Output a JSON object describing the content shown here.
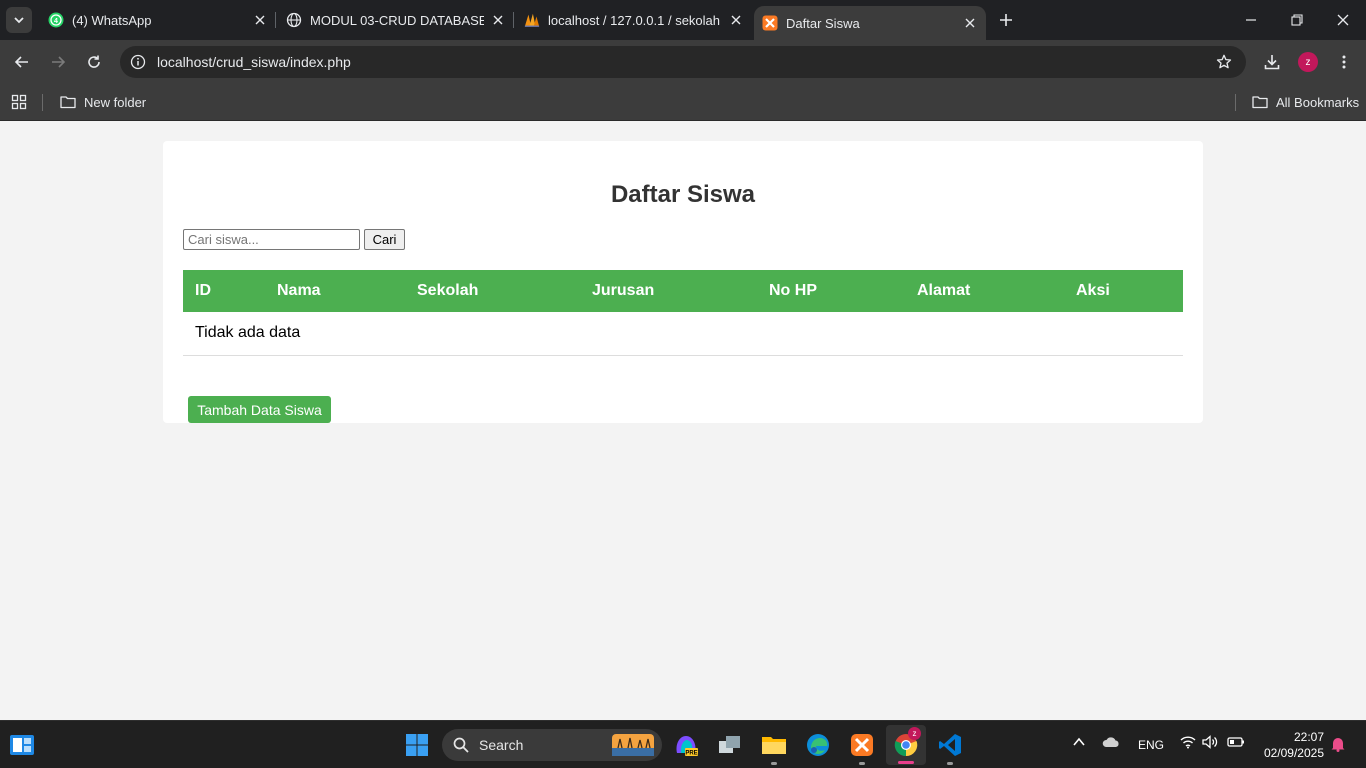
{
  "browser": {
    "tabs": [
      {
        "title": "(4) WhatsApp",
        "favicon": "whatsapp-icon",
        "active": false
      },
      {
        "title": "MODUL 03-CRUD DATABASE (1",
        "favicon": "globe-icon",
        "active": false
      },
      {
        "title": "localhost / 127.0.0.1 / sekolah /",
        "favicon": "phpmyadmin-icon",
        "active": false
      },
      {
        "title": "Daftar Siswa",
        "favicon": "xampp-icon",
        "active": true
      }
    ],
    "address": "localhost/crud_siswa/index.php",
    "profile_initial": "z",
    "bookmarks": {
      "folder": "New folder",
      "all": "All Bookmarks"
    }
  },
  "page": {
    "title": "Daftar Siswa",
    "search": {
      "placeholder": "Cari siswa...",
      "button_label": "Cari"
    },
    "table": {
      "headers": [
        "ID",
        "Nama",
        "Sekolah",
        "Jurusan",
        "No HP",
        "Alamat",
        "Aksi"
      ],
      "empty_message": "Tidak ada data"
    },
    "add_button_label": "Tambah Data Siswa"
  },
  "taskbar": {
    "search_label": "Search",
    "language": "ENG",
    "time": "22:07",
    "date": "02/09/2025",
    "chrome_badge": "z",
    "accent": "#4caf50"
  }
}
